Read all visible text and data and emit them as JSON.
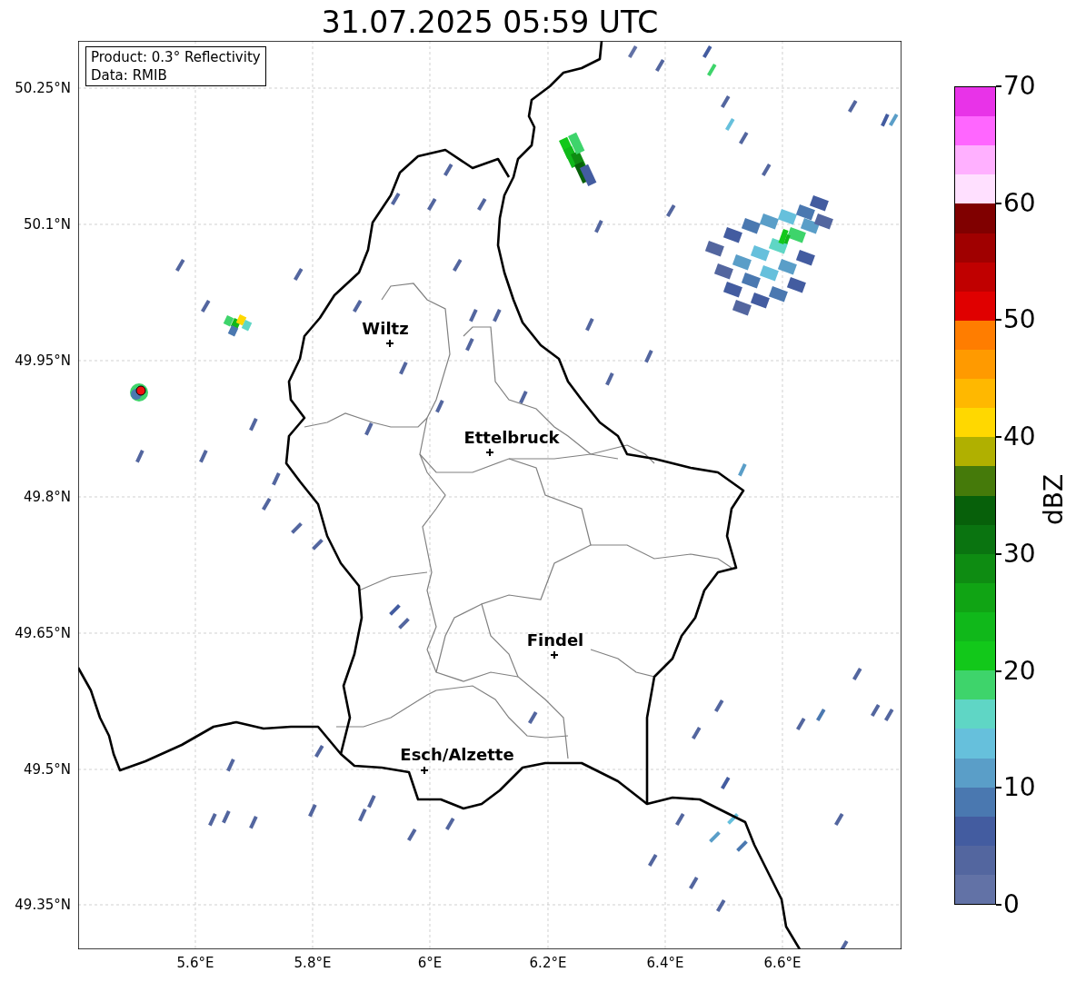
{
  "title": "31.07.2025 05:59 UTC",
  "info_box": [
    "Product: 0.3° Reflectivity",
    "Data: RMIB"
  ],
  "y_ticks": [
    "50.25°N",
    "50.1°N",
    "49.95°N",
    "49.8°N",
    "49.65°N",
    "49.5°N",
    "49.35°N"
  ],
  "x_ticks": [
    "5.6°E",
    "5.8°E",
    "6°E",
    "6.2°E",
    "6.4°E",
    "6.6°E"
  ],
  "cities": [
    {
      "name": "Wiltz"
    },
    {
      "name": "Ettelbruck"
    },
    {
      "name": "Findel"
    },
    {
      "name": "Esch/Alzette"
    }
  ],
  "colorbar": {
    "label": "dBZ",
    "ticks": [
      "70",
      "60",
      "50",
      "40",
      "30",
      "20",
      "10",
      "0"
    ],
    "bands": [
      {
        "color": "#e833e8"
      },
      {
        "color": "#ff66ff"
      },
      {
        "color": "#ffb0ff"
      },
      {
        "color": "#ffe0ff"
      },
      {
        "color": "#800000"
      },
      {
        "color": "#a00000"
      },
      {
        "color": "#c00000"
      },
      {
        "color": "#e00000"
      },
      {
        "color": "#ff7d00"
      },
      {
        "color": "#ff9a00"
      },
      {
        "color": "#ffb800"
      },
      {
        "color": "#ffd800"
      },
      {
        "color": "#b0b000"
      },
      {
        "color": "#457a0a"
      },
      {
        "color": "#07600a"
      },
      {
        "color": "#0a7410"
      },
      {
        "color": "#0e8c12"
      },
      {
        "color": "#10a414"
      },
      {
        "color": "#10b81a"
      },
      {
        "color": "#12c81a"
      },
      {
        "color": "#3ed46b"
      },
      {
        "color": "#5fd6c5"
      },
      {
        "color": "#66c0dc"
      },
      {
        "color": "#5a9ec8"
      },
      {
        "color": "#4a78b0"
      },
      {
        "color": "#435ca0"
      },
      {
        "color": "#53669f"
      },
      {
        "color": "#6272a6"
      }
    ]
  }
}
